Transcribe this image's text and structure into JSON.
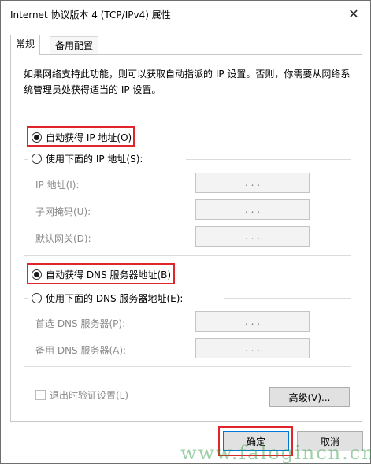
{
  "window": {
    "title": "Internet 协议版本 4 (TCP/IPv4) 属性",
    "close_icon": "✕"
  },
  "tabs": [
    {
      "label": "常规",
      "active": true
    },
    {
      "label": "备用配置",
      "active": false
    }
  ],
  "description": "如果网络支持此功能，则可以获取自动指派的 IP 设置。否则，你需要从网络系统管理员处获得适当的 IP 设置。",
  "ip_section": {
    "auto_label": "自动获得 IP 地址(O)",
    "auto_checked": true,
    "manual_label": "使用下面的 IP 地址(S):",
    "manual_checked": false,
    "fields": [
      {
        "label": "IP 地址(I):",
        "value": ". . ."
      },
      {
        "label": "子网掩码(U):",
        "value": ". . ."
      },
      {
        "label": "默认网关(D):",
        "value": ". . ."
      }
    ]
  },
  "dns_section": {
    "auto_label": "自动获得 DNS 服务器地址(B)",
    "auto_checked": true,
    "manual_label": "使用下面的 DNS 服务器地址(E):",
    "manual_checked": false,
    "fields": [
      {
        "label": "首选 DNS 服务器(P):",
        "value": ". . ."
      },
      {
        "label": "备用 DNS 服务器(A):",
        "value": ". . ."
      }
    ]
  },
  "validate_checkbox": {
    "label": "退出时验证设置(L)",
    "checked": false
  },
  "buttons": {
    "advanced": "高级(V)...",
    "ok": "确定",
    "cancel": "取消"
  },
  "watermark": "www.falogincn.cn",
  "colors": {
    "highlight": "#e0262c",
    "focus": "#0078d7",
    "watermark": "#2a963c"
  }
}
